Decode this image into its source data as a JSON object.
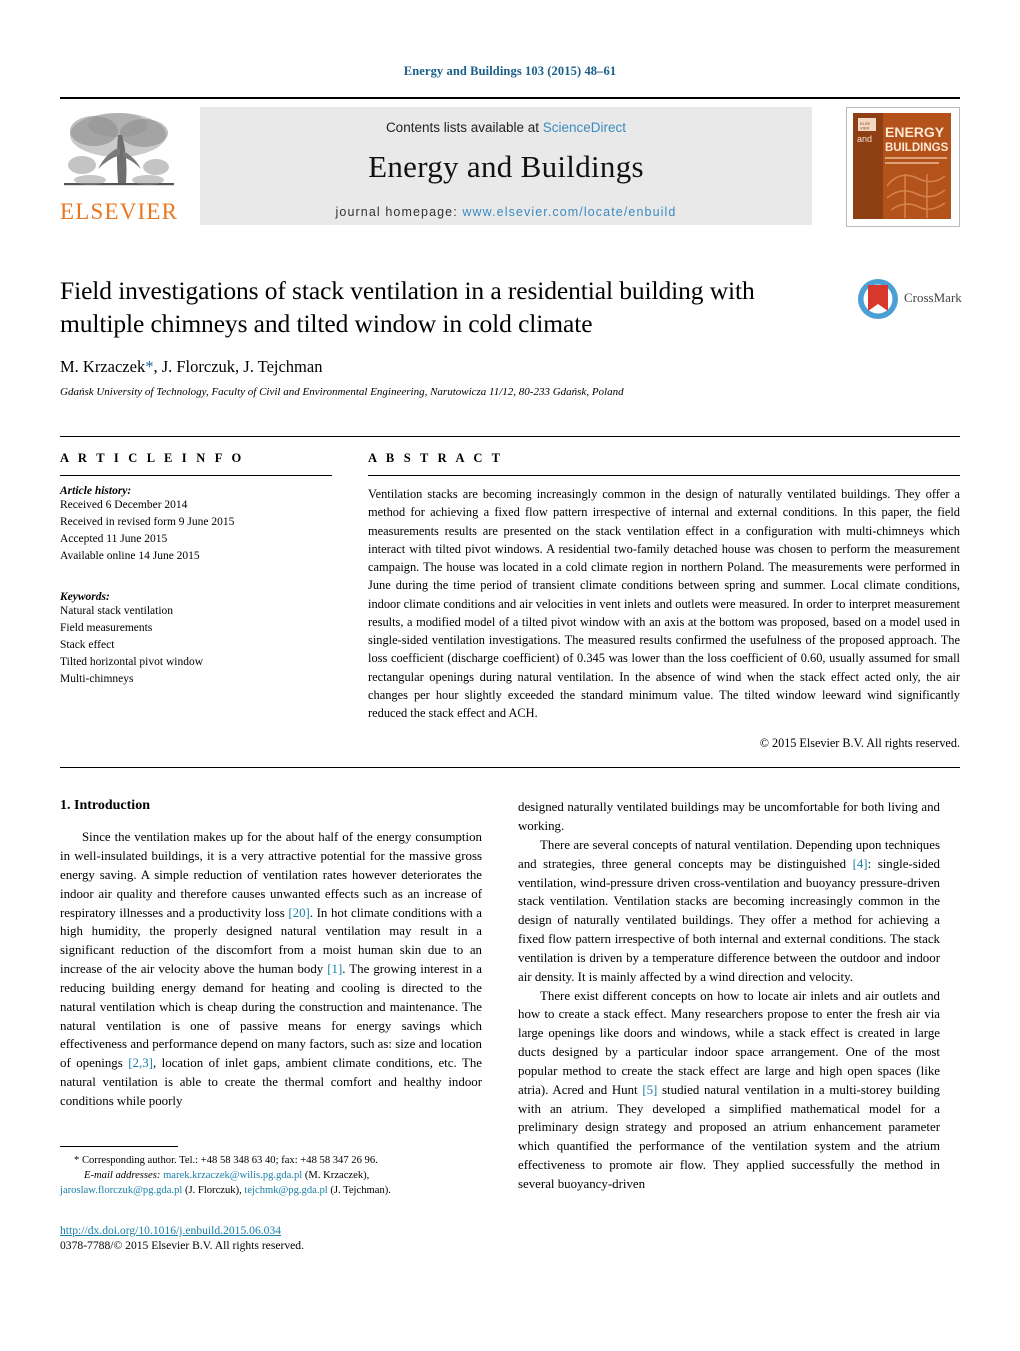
{
  "running_head": "Energy and Buildings 103 (2015) 48–61",
  "masthead": {
    "contents_prefix": "Contents lists available at ",
    "sciencedirect": "ScienceDirect",
    "journal_title": "Energy and Buildings",
    "homepage_prefix": "journal homepage: ",
    "homepage_url": "www.elsevier.com/locate/enbuild",
    "publisher_logo_text": "ELSEVIER",
    "cover_and": "and",
    "cover_energy": "ENERGY",
    "cover_buildings": "BUILDINGS"
  },
  "article": {
    "title": "Field investigations of stack ventilation in a residential building with multiple chimneys and tilted window in cold climate",
    "authors": "M. Krzaczek",
    "authors_rest": ", J. Florczuk, J. Tejchman",
    "corresponding_star": "*",
    "affiliation": "Gdańsk University of Technology, Faculty of Civil and Environmental Engineering, Narutowicza 11/12, 80-233 Gdańsk, Poland",
    "crossmark_label": "CrossMark"
  },
  "info": {
    "heading": "A R T I C L E   I N F O",
    "history_heading": "Article history:",
    "history": [
      "Received 6 December 2014",
      "Received in revised form 9 June 2015",
      "Accepted 11 June 2015",
      "Available online 14 June 2015"
    ],
    "keywords_heading": "Keywords:",
    "keywords": [
      "Natural stack ventilation",
      "Field measurements",
      "Stack effect",
      "Tilted horizontal pivot window",
      "Multi-chimneys"
    ]
  },
  "abstract": {
    "heading": "A B S T R A C T",
    "text": "Ventilation stacks are becoming increasingly common in the design of naturally ventilated buildings. They offer a method for achieving a fixed flow pattern irrespective of internal and external conditions. In this paper, the field measurements results are presented on the stack ventilation effect in a configuration with multi-chimneys which interact with tilted pivot windows. A residential two-family detached house was chosen to perform the measurement campaign. The house was located in a cold climate region in northern Poland. The measurements were performed in June during the time period of transient climate conditions between spring and summer. Local climate conditions, indoor climate conditions and air velocities in vent inlets and outlets were measured. In order to interpret measurement results, a modified model of a tilted pivot window with an axis at the bottom was proposed, based on a model used in single-sided ventilation investigations. The measured results confirmed the usefulness of the proposed approach. The loss coefficient (discharge coefficient) of 0.345 was lower than the loss coefficient of 0.60, usually assumed for small rectangular openings during natural ventilation. In the absence of wind when the stack effect acted only, the air changes per hour slightly exceeded the standard minimum value. The tilted window leeward wind significantly reduced the stack effect and ACH.",
    "copyright": "© 2015 Elsevier B.V. All rights reserved."
  },
  "body": {
    "section_heading": "1.  Introduction",
    "left_p1_a": "Since the ventilation makes up for the about half of the energy consumption in well-insulated buildings, it is a very attractive potential for the massive gross energy saving. A simple reduction of ventilation rates however deteriorates the indoor air quality and therefore causes unwanted effects such as an increase of respiratory illnesses and a productivity loss ",
    "left_ref_20": "[20]",
    "left_p1_b": ". In hot climate conditions with a high humidity, the properly designed natural ventilation may result in a significant reduction of the discomfort from a moist human skin due to an increase of the air velocity above the human body ",
    "left_ref_1": "[1]",
    "left_p1_c": ". The growing interest in a reducing building energy demand for heating and cooling is directed to the natural ventilation which is cheap during the construction and maintenance. The natural ventilation is one of passive means for energy savings which effectiveness and performance depend on many factors, such as: size and location of openings ",
    "left_ref_23": "[2,3]",
    "left_p1_d": ", location of inlet gaps, ambient climate conditions, etc. The natural ventilation is able to create the thermal comfort and healthy indoor conditions while poorly",
    "right_p1": "designed naturally ventilated buildings may be uncomfortable for both living and working.",
    "right_p2_a": "There are several concepts of natural ventilation. Depending upon techniques and strategies, three general concepts may be distinguished ",
    "right_ref_4": "[4]",
    "right_p2_b": ": single-sided ventilation, wind-pressure driven cross-ventilation and buoyancy pressure-driven stack ventilation. Ventilation stacks are becoming increasingly common in the design of naturally ventilated buildings. They offer a method for achieving a fixed flow pattern irrespective of both internal and external conditions. The stack ventilation is driven by a temperature difference between the outdoor and indoor air density. It is mainly affected by a wind direction and velocity.",
    "right_p3_a": "There exist different concepts on how to locate air inlets and air outlets and how to create a stack effect. Many researchers propose to enter the fresh air via large openings like doors and windows, while a stack effect is created in large ducts designed by a particular indoor space arrangement. One of the most popular method to create the stack effect are large and high open spaces (like atria). Acred and Hunt ",
    "right_ref_5": "[5]",
    "right_p3_b": " studied natural ventilation in a multi-storey building with an atrium. They developed a simplified mathematical model for a preliminary design strategy and proposed an atrium enhancement parameter which quantified the performance of the ventilation system and the atrium effectiveness to promote air flow. They applied successfully the method in several buoyancy-driven"
  },
  "footnotes": {
    "corresponding": "* Corresponding author. Tel.: +48 58 348 63 40; fax: +48 58 347 26 96.",
    "email_label": "E-mail addresses:",
    "email1": "marek.krzaczek@wilis.pg.gda.pl",
    "email1_who": " (M. Krzaczek),",
    "email2": "jaroslaw.florczuk@pg.gda.pl",
    "email2_who": " (J. Florczuk), ",
    "email3": "tejchmk@pg.gda.pl",
    "email3_who": " (J. Tejchman).",
    "doi": "http://dx.doi.org/10.1016/j.enbuild.2015.06.034",
    "issn": "0378-7788/© 2015 Elsevier B.V. All rights reserved."
  },
  "colors": {
    "link": "#1a7fa8",
    "running_head": "#1a5f8a",
    "elsevier_orange": "#E87722",
    "band_gray": "#e9e9e9"
  }
}
